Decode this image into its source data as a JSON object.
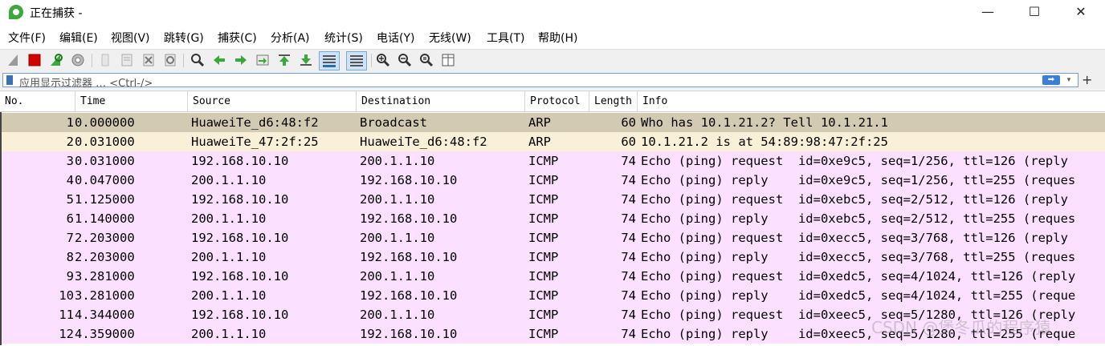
{
  "window": {
    "title": "正在捕获 -",
    "controls": {
      "minimize": "—",
      "maximize": "☐",
      "close": "✕"
    }
  },
  "menu": [
    "文件(F)",
    "编辑(E)",
    "视图(V)",
    "跳转(G)",
    "捕获(C)",
    "分析(A)",
    "统计(S)",
    "电话(Y)",
    "无线(W)",
    "工具(T)",
    "帮助(H)"
  ],
  "toolbar_icons": [
    "shark-fin-start-icon",
    "stop-capture-icon",
    "restart-capture-icon",
    "capture-options-icon",
    "open-file-icon",
    "save-file-icon",
    "close-file-icon",
    "reload-icon",
    "find-packet-icon",
    "go-back-icon",
    "go-forward-icon",
    "go-to-packet-icon",
    "go-first-icon",
    "go-last-icon",
    "auto-scroll-icon",
    "colorize-icon",
    "zoom-in-icon",
    "zoom-out-icon",
    "normal-size-icon",
    "resize-columns-icon"
  ],
  "filter": {
    "placeholder": "应用显示过滤器 … <Ctrl-/>",
    "apply_label": "➡",
    "dropdown_label": "▾",
    "add_label": "+"
  },
  "columns": {
    "no": "No.",
    "time": "Time",
    "source": "Source",
    "destination": "Destination",
    "protocol": "Protocol",
    "length": "Length",
    "info": "Info"
  },
  "packets": [
    {
      "no": "1",
      "time": "0.000000",
      "source": "HuaweiTe_d6:48:f2",
      "destination": "Broadcast",
      "protocol": "ARP",
      "length": "60",
      "info": "Who has 10.1.21.2? Tell 10.1.21.1",
      "bg": "#d3cbb1"
    },
    {
      "no": "2",
      "time": "0.031000",
      "source": "HuaweiTe_47:2f:25",
      "destination": "HuaweiTe_d6:48:f2",
      "protocol": "ARP",
      "length": "60",
      "info": "10.1.21.2 is at 54:89:98:47:2f:25",
      "bg": "#faf0d7"
    },
    {
      "no": "3",
      "time": "0.031000",
      "source": "192.168.10.10",
      "destination": "200.1.1.10",
      "protocol": "ICMP",
      "length": "74",
      "info": "Echo (ping) request  id=0xe9c5, seq=1/256, ttl=126 (reply",
      "bg": "#fce0ff"
    },
    {
      "no": "4",
      "time": "0.047000",
      "source": "200.1.1.10",
      "destination": "192.168.10.10",
      "protocol": "ICMP",
      "length": "74",
      "info": "Echo (ping) reply    id=0xe9c5, seq=1/256, ttl=255 (reques",
      "bg": "#fce0ff"
    },
    {
      "no": "5",
      "time": "1.125000",
      "source": "192.168.10.10",
      "destination": "200.1.1.10",
      "protocol": "ICMP",
      "length": "74",
      "info": "Echo (ping) request  id=0xebc5, seq=2/512, ttl=126 (reply",
      "bg": "#fce0ff"
    },
    {
      "no": "6",
      "time": "1.140000",
      "source": "200.1.1.10",
      "destination": "192.168.10.10",
      "protocol": "ICMP",
      "length": "74",
      "info": "Echo (ping) reply    id=0xebc5, seq=2/512, ttl=255 (reques",
      "bg": "#fce0ff"
    },
    {
      "no": "7",
      "time": "2.203000",
      "source": "192.168.10.10",
      "destination": "200.1.1.10",
      "protocol": "ICMP",
      "length": "74",
      "info": "Echo (ping) request  id=0xecc5, seq=3/768, ttl=126 (reply",
      "bg": "#fce0ff"
    },
    {
      "no": "8",
      "time": "2.203000",
      "source": "200.1.1.10",
      "destination": "192.168.10.10",
      "protocol": "ICMP",
      "length": "74",
      "info": "Echo (ping) reply    id=0xecc5, seq=3/768, ttl=255 (reques",
      "bg": "#fce0ff"
    },
    {
      "no": "9",
      "time": "3.281000",
      "source": "192.168.10.10",
      "destination": "200.1.1.10",
      "protocol": "ICMP",
      "length": "74",
      "info": "Echo (ping) request  id=0xedc5, seq=4/1024, ttl=126 (reply",
      "bg": "#fce0ff"
    },
    {
      "no": "10",
      "time": "3.281000",
      "source": "200.1.1.10",
      "destination": "192.168.10.10",
      "protocol": "ICMP",
      "length": "74",
      "info": "Echo (ping) reply    id=0xedc5, seq=4/1024, ttl=255 (reque",
      "bg": "#fce0ff"
    },
    {
      "no": "11",
      "time": "4.344000",
      "source": "192.168.10.10",
      "destination": "200.1.1.10",
      "protocol": "ICMP",
      "length": "74",
      "info": "Echo (ping) request  id=0xeec5, seq=5/1280, ttl=126 (reply",
      "bg": "#fce0ff"
    },
    {
      "no": "12",
      "time": "4.359000",
      "source": "200.1.1.10",
      "destination": "192.168.10.10",
      "protocol": "ICMP",
      "length": "74",
      "info": "Echo (ping) reply    id=0xeec5, seq=5/1280, ttl=255 (reque",
      "bg": "#fce0ff"
    }
  ],
  "watermark": "CSDN @煲冬瓜的程序猿",
  "colors": {
    "arp_request": "#d3cbb1",
    "arp_reply": "#faf0d7",
    "icmp": "#fce0ff",
    "accent": "#3d7fd1"
  }
}
